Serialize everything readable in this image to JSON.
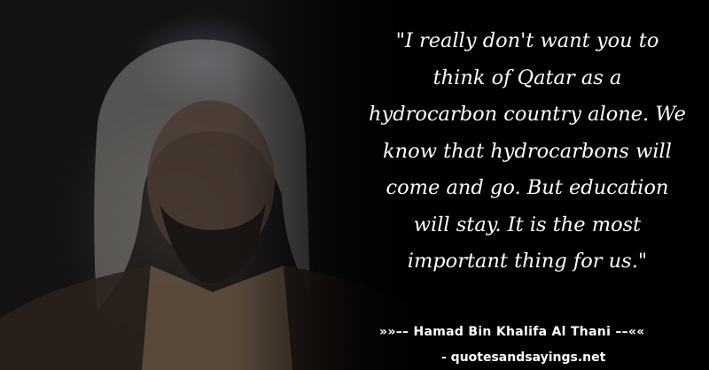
{
  "quote": {
    "text": "\"I really don't want you to think of Qatar as a hydrocarbon country alone. We know that hydrocarbons will come and go. But education will stay. It is the most important thing for us.\"",
    "lines": [
      "\"I really don't want you to",
      "think of Qatar as a",
      "hydrocarbon country alone. We",
      "know that hydrocarbons will",
      "come and go. But education",
      "will stay. It is the most",
      "important thing for us.\""
    ]
  },
  "attribution": {
    "author_line": "»»–– Hamad Bin Khalifa Al Thani ––««",
    "source_line": "- quotesandsayings.net"
  },
  "colors": {
    "background": "#000000",
    "text": "#ffffff"
  }
}
